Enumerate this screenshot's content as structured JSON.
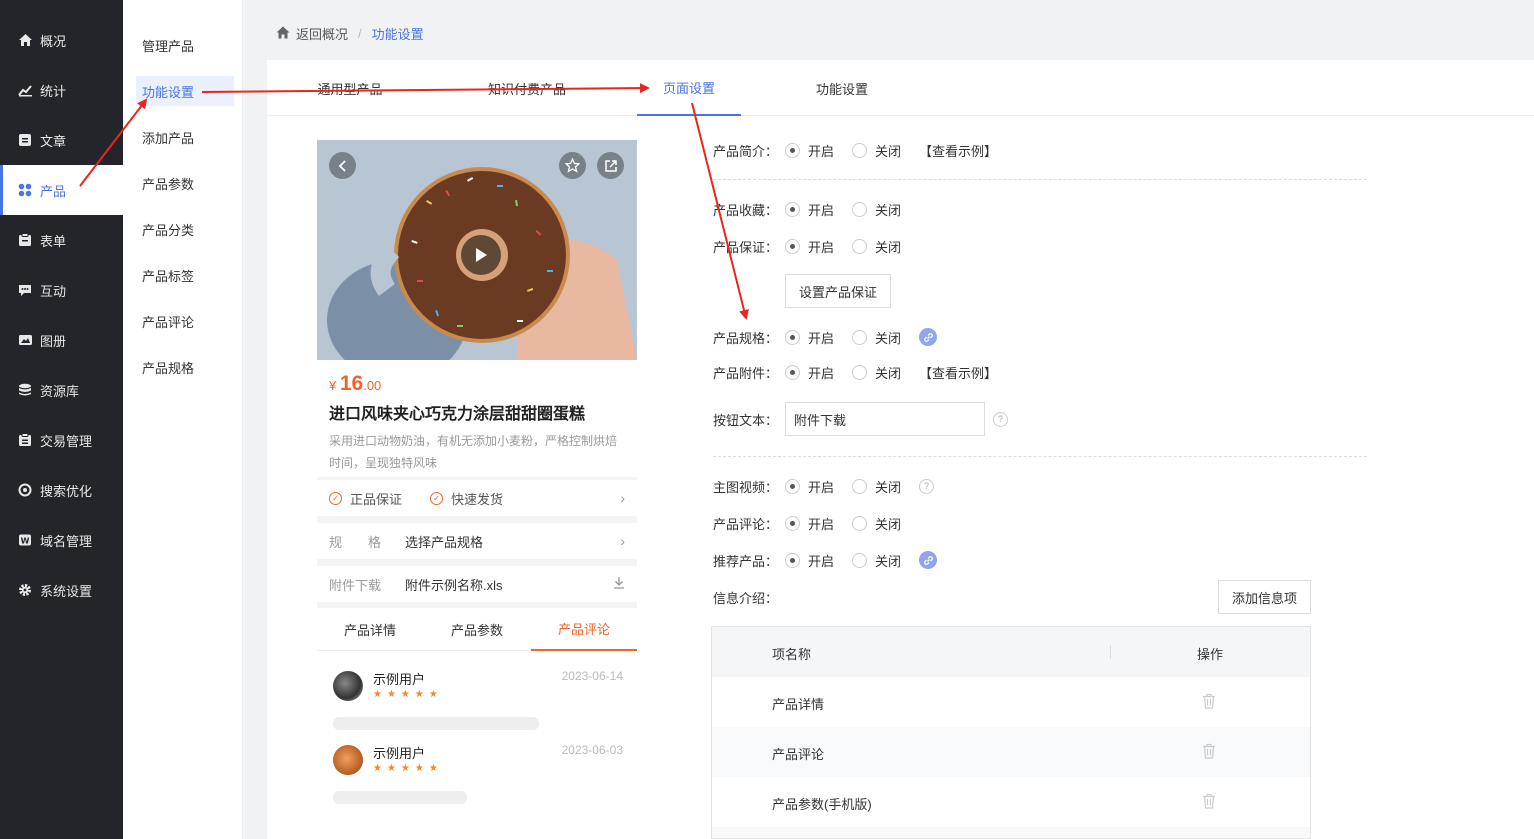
{
  "sidebar": {
    "items": [
      {
        "label": "概况",
        "icon": "home-icon"
      },
      {
        "label": "统计",
        "icon": "chart-icon"
      },
      {
        "label": "文章",
        "icon": "article-icon"
      },
      {
        "label": "产品",
        "icon": "grid-icon"
      },
      {
        "label": "表单",
        "icon": "form-icon"
      },
      {
        "label": "互动",
        "icon": "chat-icon"
      },
      {
        "label": "图册",
        "icon": "album-icon"
      },
      {
        "label": "资源库",
        "icon": "database-icon"
      },
      {
        "label": "交易管理",
        "icon": "trade-icon"
      },
      {
        "label": "搜索优化",
        "icon": "seo-icon"
      },
      {
        "label": "域名管理",
        "icon": "domain-icon"
      },
      {
        "label": "系统设置",
        "icon": "gear-icon"
      }
    ],
    "active_index": 3
  },
  "submenu": {
    "items": [
      "管理产品",
      "功能设置",
      "添加产品",
      "产品参数",
      "产品分类",
      "产品标签",
      "产品评论",
      "产品规格"
    ],
    "active_index": 1
  },
  "breadcrumb": {
    "back": "返回概况",
    "current": "功能设置"
  },
  "tabs": [
    "通用型产品",
    "知识付费产品",
    "页面设置",
    "功能设置"
  ],
  "preview": {
    "price_symbol": "¥",
    "price_int": "16",
    "price_dec": ".00",
    "title": "进口风味夹心巧克力涂层甜甜圈蛋糕",
    "desc": "采用进口动物奶油，有机无添加小麦粉，严格控制烘焙时间，呈现独特风味",
    "tags": [
      "正品保证",
      "快速发货"
    ],
    "spec_label": "规　　格",
    "spec_value": "选择产品规格",
    "attach_label": "附件下载",
    "attach_value": "附件示例名称.xls",
    "tabs": [
      "产品详情",
      "产品参数",
      "产品评论"
    ],
    "comments": [
      {
        "user": "示例用户",
        "date": "2023-06-14",
        "stars": "★★★★★"
      },
      {
        "user": "示例用户",
        "date": "2023-06-03",
        "stars": "★★★★★"
      }
    ]
  },
  "form": {
    "on": "开启",
    "off": "关闭",
    "example": "【查看示例】",
    "intro": "产品简介：",
    "favorite": "产品收藏：",
    "guarantee": "产品保证：",
    "guarantee_btn": "设置产品保证",
    "spec": "产品规格：",
    "attach": "产品附件：",
    "btn_text_label": "按钮文本：",
    "btn_text_value": "附件下载",
    "video": "主图视频：",
    "review": "产品评论：",
    "recommend": "推荐产品：",
    "info": "信息介绍：",
    "add_info_btn": "添加信息项"
  },
  "table": {
    "headers": [
      "项名称",
      "操作"
    ],
    "rows": [
      "产品详情",
      "产品评论",
      "产品参数(手机版)"
    ]
  },
  "colors": {
    "accent": "#4a73e6",
    "price": "#f0652e",
    "sidebar": "#23252b",
    "arrow": "#e8261c"
  }
}
